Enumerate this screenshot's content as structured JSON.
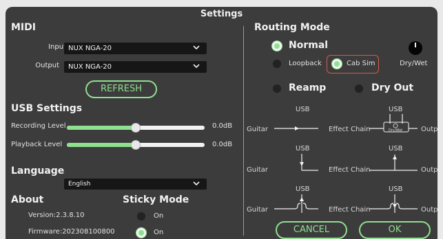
{
  "window": {
    "title": "Settings"
  },
  "midi": {
    "heading": "MIDI",
    "input_label": "Input",
    "input_value": "NUX NGA-20",
    "output_label": "Output",
    "output_value": "NUX NGA-20",
    "refresh_label": "REFRESH"
  },
  "usb": {
    "heading": "USB Settings",
    "recording_label": "Recording Level",
    "recording_value": "0.0dB",
    "recording_level_fraction": 0.5,
    "playback_label": "Playback Level",
    "playback_value": "0.0dB",
    "playback_level_fraction": 0.5
  },
  "language": {
    "heading": "Language",
    "value": "English"
  },
  "about": {
    "heading": "About",
    "version": "Version:2.3.8.10",
    "firmware": "Firmware:202308100800"
  },
  "sticky": {
    "heading": "Sticky Mode",
    "option1": "On",
    "option2": "On"
  },
  "routing": {
    "heading": "Routing Mode",
    "normal": "Normal",
    "loopback": "Loopback",
    "cab_sim": "Cab Sim",
    "dry_wet": "Dry/Wet",
    "reamp": "Reamp",
    "dry_out": "Dry Out"
  },
  "diagrams": {
    "usb": "USB",
    "guitar": "Guitar",
    "effect_chain": "Effect Chain",
    "output": "Output",
    "dry_wet_small": "Dry/Wet"
  },
  "actions": {
    "cancel": "CANCEL",
    "ok": "OK"
  },
  "colors": {
    "accent": "#8fe08f",
    "panel": "#3c3c3c",
    "highlight": "#d75b4b"
  }
}
